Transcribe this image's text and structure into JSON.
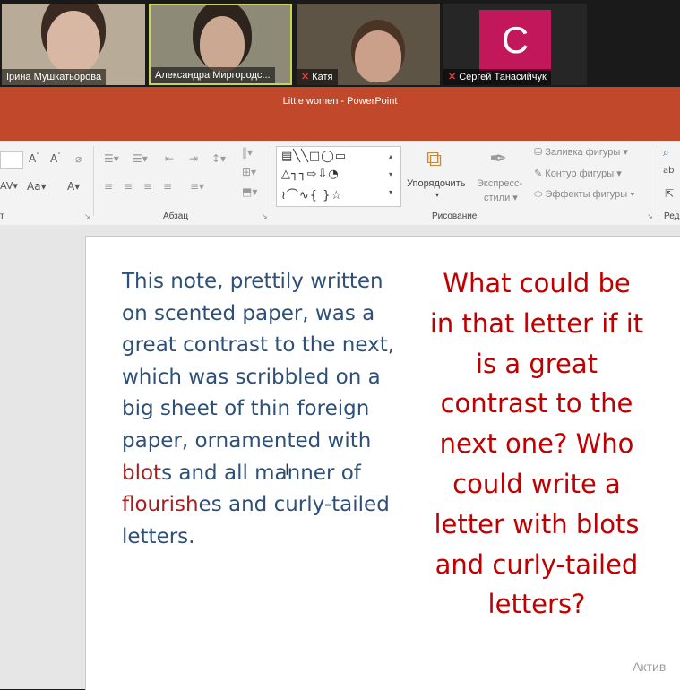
{
  "participants": [
    {
      "name": "Ірина Мушкатьорова",
      "muted": false
    },
    {
      "name": "Александра Миргородс...",
      "muted": false
    },
    {
      "name": "Катя",
      "muted": true
    },
    {
      "name": "Сергей Танасийчук",
      "muted": true,
      "avatar_letter": "С",
      "avatar_color": "#c2185b"
    }
  ],
  "window": {
    "title": "Little women - PowerPoint"
  },
  "ribbon": {
    "group_font_label": "т",
    "group_paragraph_label": "Абзац",
    "group_drawing_label": "Рисование",
    "group_editing_label": "Ред",
    "arrange_label": "Упорядочить",
    "quick_styles_label_1": "Экспресс-",
    "quick_styles_label_2": "стили",
    "shape_fill_label": "Заливка фигуры",
    "shape_outline_label": "Контур фигуры",
    "shape_effects_label": "Эффекты фигуры"
  },
  "slide": {
    "body_lines": [
      {
        "parts": [
          {
            "text": "This note, prettily written",
            "red": false
          }
        ]
      },
      {
        "parts": [
          {
            "text": "on scented paper, was a",
            "red": false
          }
        ]
      },
      {
        "parts": [
          {
            "text": "great contrast to the next,",
            "red": false
          }
        ]
      },
      {
        "parts": [
          {
            "text": "which was scribbled on a",
            "red": false
          }
        ]
      },
      {
        "parts": [
          {
            "text": "big sheet of thin foreign",
            "red": false
          }
        ]
      },
      {
        "parts": [
          {
            "text": "paper, ornamented with",
            "red": false
          }
        ]
      },
      {
        "parts": [
          {
            "text": "blot",
            "red": true
          },
          {
            "text": "s and all manner of",
            "red": false
          }
        ]
      },
      {
        "parts": [
          {
            "text": "flourish",
            "red": true
          },
          {
            "text": "es and curly-tailed",
            "red": false
          }
        ]
      },
      {
        "parts": [
          {
            "text": "letters.",
            "red": false
          }
        ]
      }
    ],
    "question_lines": [
      "What could be",
      "in that letter if it",
      "is a great",
      "contrast to the",
      "next one? Who",
      "could write a",
      "letter with blots",
      "and curly-tailed",
      "letters?"
    ]
  },
  "watermark": {
    "text": "Актив"
  },
  "colors": {
    "titlebar": "#c2482b",
    "body_text": "#2e5078",
    "question_text": "#c00000",
    "highlight_red": "#a81e1e"
  }
}
